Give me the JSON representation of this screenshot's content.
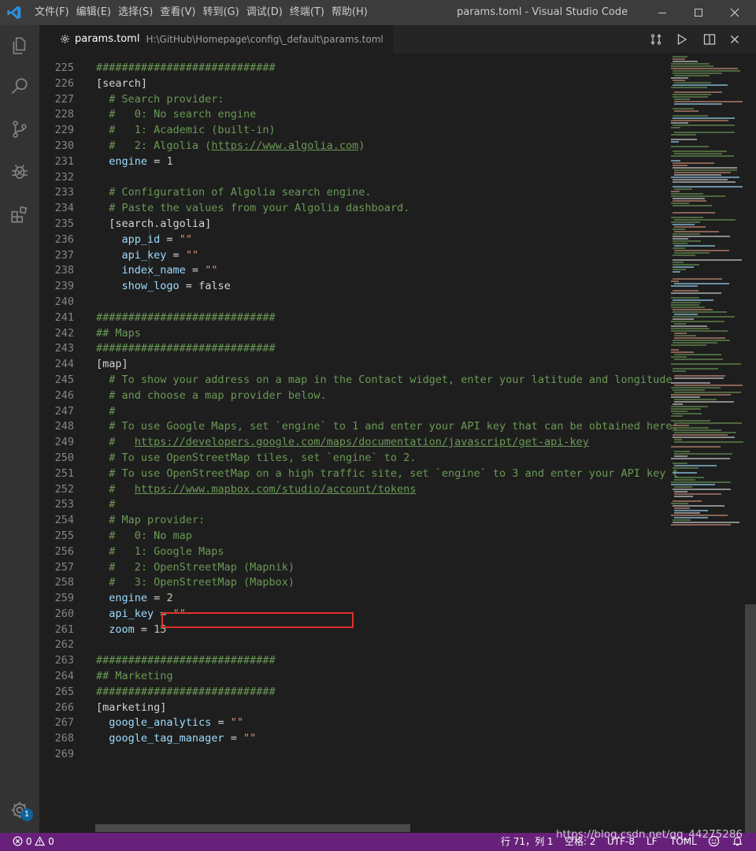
{
  "window": {
    "title": "params.toml - Visual Studio Code",
    "menu": [
      "文件(F)",
      "编辑(E)",
      "选择(S)",
      "查看(V)",
      "转到(G)",
      "调试(D)",
      "终端(T)",
      "帮助(H)"
    ]
  },
  "activity_bar": {
    "items": [
      "files-icon",
      "search-icon",
      "source-control-icon",
      "debug-icon",
      "extensions-icon"
    ],
    "settings_badge": "1"
  },
  "tab": {
    "name": "params.toml",
    "path": "H:\\GitHub\\Homepage\\config\\_default\\params.toml"
  },
  "editor": {
    "lines": [
      {
        "n": "225",
        "html": "<span class=\"c\">############################</span>"
      },
      {
        "n": "226",
        "html": "<span class=\"t\">[search]</span>"
      },
      {
        "n": "227",
        "html": "  <span class=\"c\"># Search provider:</span>"
      },
      {
        "n": "228",
        "html": "  <span class=\"c\">#   0: No search engine</span>"
      },
      {
        "n": "229",
        "html": "  <span class=\"c\">#   1: Academic (built-in)</span>"
      },
      {
        "n": "230",
        "html": "  <span class=\"c\">#   2: Algolia (<span class=\"u\">https://www.algolia.com</span>)</span>"
      },
      {
        "n": "231",
        "html": "  <span class=\"k\">engine</span> = <span class=\"n\">1</span>"
      },
      {
        "n": "232",
        "html": ""
      },
      {
        "n": "233",
        "html": "  <span class=\"c\"># Configuration of Algolia search engine.</span>"
      },
      {
        "n": "234",
        "html": "  <span class=\"c\"># Paste the values from your Algolia dashboard.</span>"
      },
      {
        "n": "235",
        "html": "  <span class=\"t\">[search.algolia]</span>"
      },
      {
        "n": "236",
        "html": "    <span class=\"k\">app_id</span> = <span class=\"s\">\"\"</span>"
      },
      {
        "n": "237",
        "html": "    <span class=\"k\">api_key</span> = <span class=\"s\">\"\"</span>"
      },
      {
        "n": "238",
        "html": "    <span class=\"k\">index_name</span> = <span class=\"s\">\"\"</span>"
      },
      {
        "n": "239",
        "html": "    <span class=\"k\">show_logo</span> = <span class=\"t\">false</span>"
      },
      {
        "n": "240",
        "html": ""
      },
      {
        "n": "241",
        "html": "<span class=\"c\">############################</span>"
      },
      {
        "n": "242",
        "html": "<span class=\"c\">## Maps</span>"
      },
      {
        "n": "243",
        "html": "<span class=\"c\">############################</span>"
      },
      {
        "n": "244",
        "html": "<span class=\"t\">[map]</span>"
      },
      {
        "n": "245",
        "html": "  <span class=\"c\"># To show your address on a map in the Contact widget, enter your latitude and longitude</span>"
      },
      {
        "n": "246",
        "html": "  <span class=\"c\"># and choose a map provider below.</span>"
      },
      {
        "n": "247",
        "html": "  <span class=\"c\">#</span>"
      },
      {
        "n": "248",
        "html": "  <span class=\"c\"># To use Google Maps, set `engine` to 1 and enter your API key that can be obtained here:</span>"
      },
      {
        "n": "249",
        "html": "  <span class=\"c\">#   <span class=\"u\">https://developers.google.com/maps/documentation/javascript/get-api-key</span></span>"
      },
      {
        "n": "250",
        "html": "  <span class=\"c\"># To use OpenStreetMap tiles, set `engine` to 2.</span>"
      },
      {
        "n": "251",
        "html": "  <span class=\"c\"># To use OpenStreetMap on a high traffic site, set `engine` to 3 and enter your API key t</span>"
      },
      {
        "n": "252",
        "html": "  <span class=\"c\">#   <span class=\"u\">https://www.mapbox.com/studio/account/tokens</span></span>"
      },
      {
        "n": "253",
        "html": "  <span class=\"c\">#</span>"
      },
      {
        "n": "254",
        "html": "  <span class=\"c\"># Map provider:</span>"
      },
      {
        "n": "255",
        "html": "  <span class=\"c\">#   0: No map</span>"
      },
      {
        "n": "256",
        "html": "  <span class=\"c\">#   1: Google Maps</span>"
      },
      {
        "n": "257",
        "html": "  <span class=\"c\">#   2: OpenStreetMap (Mapnik)</span>"
      },
      {
        "n": "258",
        "html": "  <span class=\"c\">#   3: OpenStreetMap (Mapbox)</span>"
      },
      {
        "n": "259",
        "html": "  <span class=\"k\">engine</span> = <span class=\"n\">2</span>"
      },
      {
        "n": "260",
        "html": "  <span class=\"k\">api_key</span> = <span class=\"s\">\"\"</span>"
      },
      {
        "n": "261",
        "html": "  <span class=\"k\">zoom</span> = <span class=\"n\">15</span>"
      },
      {
        "n": "262",
        "html": ""
      },
      {
        "n": "263",
        "html": "<span class=\"c\">############################</span>"
      },
      {
        "n": "264",
        "html": "<span class=\"c\">## Marketing</span>"
      },
      {
        "n": "265",
        "html": "<span class=\"c\">############################</span>"
      },
      {
        "n": "266",
        "html": "<span class=\"t\">[marketing]</span>"
      },
      {
        "n": "267",
        "html": "  <span class=\"k\">google_analytics</span> = <span class=\"s\">\"\"</span>"
      },
      {
        "n": "268",
        "html": "  <span class=\"k\">google_tag_manager</span> = <span class=\"s\">\"\"</span>"
      },
      {
        "n": "269",
        "html": ""
      }
    ]
  },
  "status_bar": {
    "errors": "0",
    "warnings": "0",
    "position": "行 71，列 1",
    "indent": "空格: 2",
    "encoding": "UTF-8",
    "eol": "LF",
    "language": "TOML",
    "color": "#68217a"
  },
  "watermark": "https://blog.csdn.net/qq_44275286"
}
